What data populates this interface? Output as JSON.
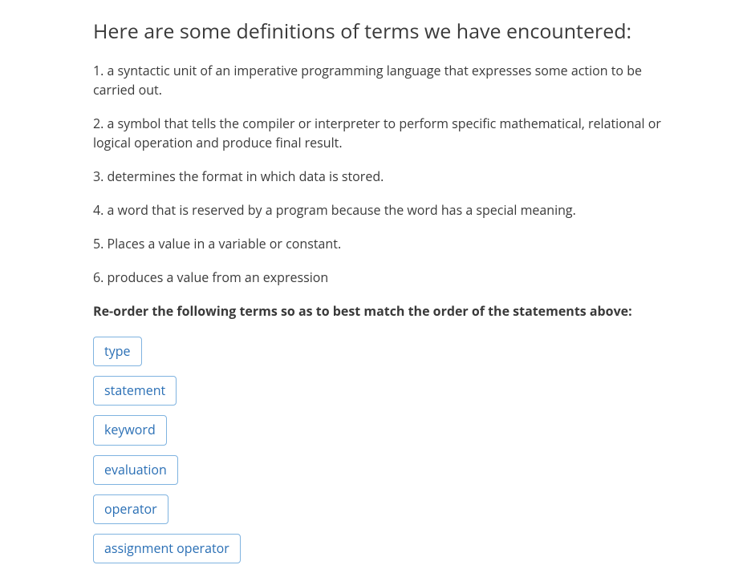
{
  "heading": "Here are some definitions of terms we have encountered:",
  "definitions": [
    "1. a syntactic unit of an imperative programming language that expresses some action to be carried out.",
    "2. a symbol that tells the compiler or interpreter to perform specific mathematical, relational or logical operation and produce final result.",
    "3. determines the format in which data is stored.",
    "4. a word that is reserved by a program because the word has a special meaning.",
    "5. Places a value in a variable or constant.",
    "6. produces a value from an expression"
  ],
  "instruction": "Re-order the following terms so as to best match the order of the statements above:",
  "terms": [
    "type",
    "statement",
    "keyword",
    "evaluation",
    "operator",
    "assignment operator"
  ]
}
